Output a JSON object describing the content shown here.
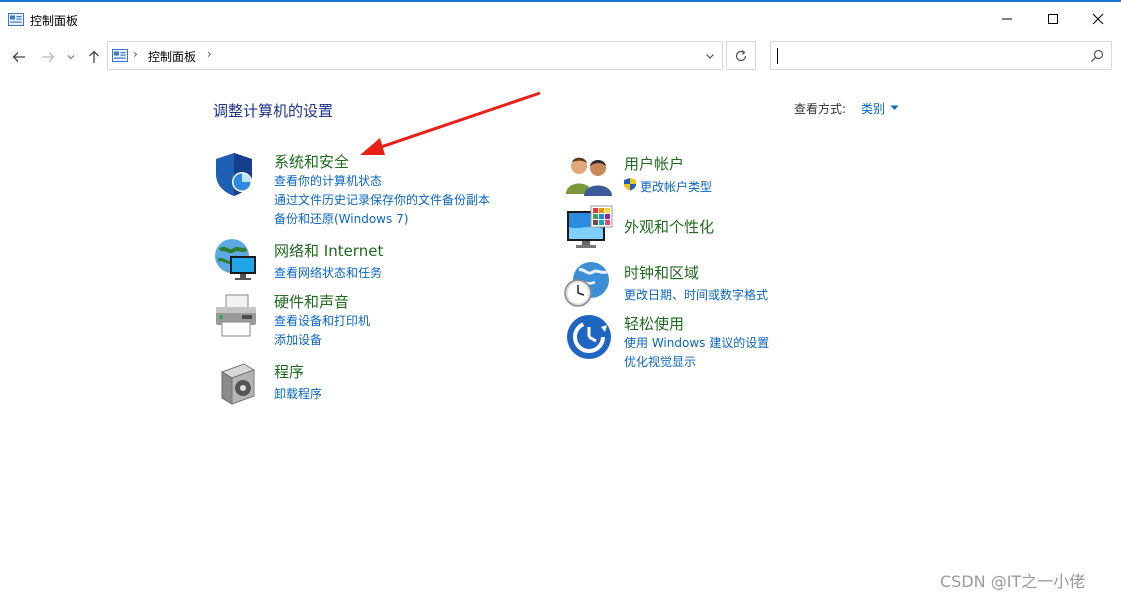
{
  "window": {
    "title": "控制面板",
    "min_icon": "minimize-icon",
    "max_icon": "maximize-icon",
    "close_icon": "close-icon"
  },
  "nav": {
    "back_icon": "arrow-left-icon",
    "forward_icon": "arrow-right-icon",
    "recent_icon": "chevron-down-icon",
    "up_icon": "arrow-up-icon",
    "address_path": "控制面板",
    "address_separator": "›",
    "refresh_icon": "refresh-icon",
    "search_value": "",
    "search_icon": "search-icon"
  },
  "content": {
    "heading": "调整计算机的设置",
    "view_by_label": "查看方式:",
    "view_by_value": "类别",
    "left_categories": [
      {
        "icon": "security-shield-icon",
        "title": "系统和安全",
        "links": [
          "查看你的计算机状态",
          "通过文件历史记录保存你的文件备份副本",
          "备份和还原(Windows 7)"
        ]
      },
      {
        "icon": "network-globe-icon",
        "title": "网络和 Internet",
        "links": [
          "查看网络状态和任务"
        ]
      },
      {
        "icon": "printer-hardware-icon",
        "title": "硬件和声音",
        "links": [
          "查看设备和打印机",
          "添加设备"
        ]
      },
      {
        "icon": "programs-disc-icon",
        "title": "程序",
        "links": [
          "卸载程序"
        ]
      }
    ],
    "right_categories": [
      {
        "icon": "user-accounts-icon",
        "title": "用户帐户",
        "links": [
          "更改帐户类型"
        ]
      },
      {
        "icon": "appearance-monitor-icon",
        "title": "外观和个性化",
        "links": []
      },
      {
        "icon": "clock-globe-icon",
        "title": "时钟和区域",
        "links": [
          "更改日期、时间或数字格式"
        ]
      },
      {
        "icon": "ease-of-access-icon",
        "title": "轻松使用",
        "links": [
          "使用 Windows 建议的设置",
          "优化视觉显示"
        ]
      }
    ]
  },
  "annotation": {
    "arrow_color": "#e8211a"
  },
  "watermark": "CSDN @IT之一小佬",
  "colors": {
    "heading": "#1e3287",
    "category_title": "#1e6b1e",
    "link": "#0b66c3",
    "accent": "#1a73d0"
  }
}
